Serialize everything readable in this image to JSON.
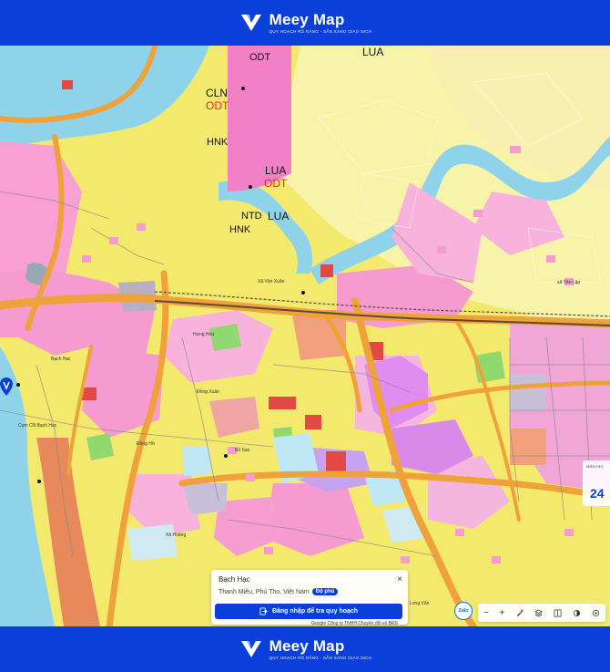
{
  "brand": {
    "name": "Meey Map",
    "tagline": "QUY HOẠCH RÕ RÀNG - SẴN SÀNG GIAO DỊCH",
    "color": "#0b3fdc"
  },
  "map": {
    "zone_labels": [
      {
        "text": "LUA",
        "color": "#111"
      },
      {
        "text": "ODT",
        "color": "#111"
      },
      {
        "text": "CLN",
        "color": "#111"
      },
      {
        "text": "ODT",
        "color": "#e0252a"
      },
      {
        "text": "HNK",
        "color": "#111"
      },
      {
        "text": "LUA",
        "color": "#111"
      },
      {
        "text": "ODT",
        "color": "#e0252a"
      },
      {
        "text": "NTD",
        "color": "#111"
      },
      {
        "text": "LUA",
        "color": "#111"
      },
      {
        "text": "HNK",
        "color": "#111"
      }
    ],
    "place_labels": [
      "Xã Vân Xuân",
      "xã Yên Lập",
      "Đồng Xuân",
      "Bồ Sao",
      "Xã Hoàng",
      "Hưng Hóa",
      "Bạch Hạc",
      "Đồng Hồ",
      "Cụm CN Bạch Hạc",
      "Long Vân"
    ],
    "right_badge_number": "24",
    "right_badge_caption": "MIỀN PHÍ"
  },
  "popup": {
    "title": "Bạch Hạc",
    "address": "Thanh Miếu, Phú Thọ, Việt Nam",
    "badge": "Độ phủ",
    "close": "×",
    "login_button": "Đăng nhập để tra quy hoạch"
  },
  "toolbar": {
    "zalo": "Zalo",
    "minus": "−",
    "plus": "+"
  },
  "attribution": "Google   Công ty TNHH Chuyển đổi số BĐS"
}
